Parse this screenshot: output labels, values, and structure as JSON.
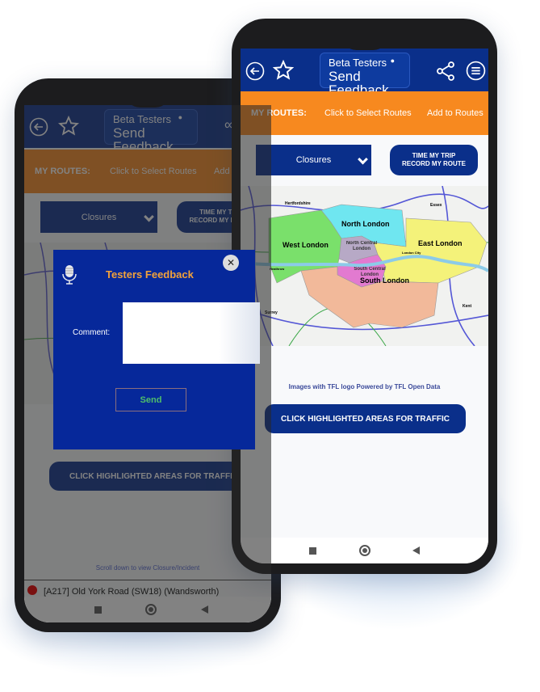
{
  "app": {
    "feedback_button": {
      "line1": "Beta Testers",
      "line2": "Send Feedback"
    },
    "my_routes_label": "MY ROUTES:",
    "select_routes": "Click to Select Routes",
    "add_routes": "Add to Routes",
    "dropdown_value": "Closures",
    "time_trip": {
      "line1": "TIME MY TRIP",
      "line2": "RECORD MY ROUTE"
    },
    "credit": "Images with TFL logo Powered by TFL Open Data",
    "traffic_button": "CLICK HIGHLIGHTED AREAS FOR TRAFFIC",
    "icons": [
      "back-arrow-icon",
      "star-icon",
      "share-icon",
      "menu-icon",
      "mic-icon",
      "close-icon"
    ],
    "colors": {
      "header": "#0a2f8a",
      "routes_bar": "#f7891f",
      "dialog": "#06289a",
      "dialog_title": "#f3a23a",
      "send": "#4fbf6a"
    }
  },
  "map": {
    "regions": {
      "north": "North London",
      "west": "West London",
      "east": "East London",
      "north_central": "North Central London",
      "south_central": "South Central London",
      "south": "South London"
    },
    "places": {
      "hertfordshire": "Hertfordshire",
      "essex": "Essex",
      "surrey": "Surrey",
      "kent": "Kent",
      "heathrow": "Heathrow",
      "london_city": "London City"
    }
  },
  "dialog": {
    "title": "Testers Feedback",
    "comment_label": "Comment:",
    "comment_value": "",
    "send_label": "Send"
  },
  "back_screen": {
    "scroll_hint": "Scroll down to view Closure/Incident",
    "incident": "[A217] Old York Road (SW18) (Wandsworth)"
  }
}
